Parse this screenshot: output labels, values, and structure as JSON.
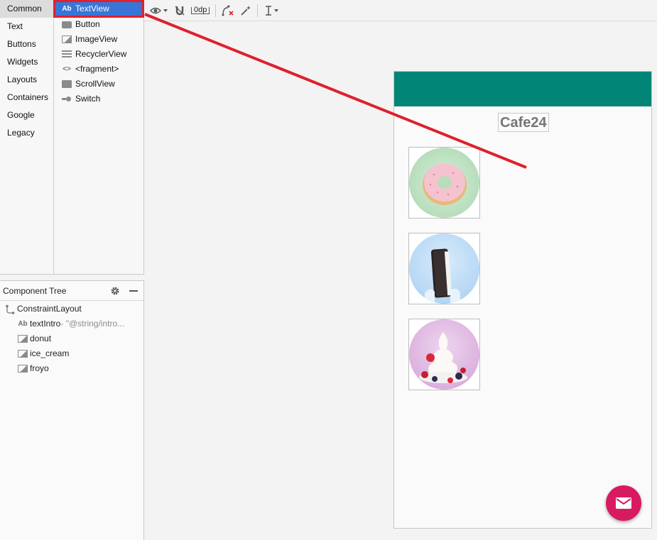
{
  "palette": {
    "categories": [
      "Common",
      "Text",
      "Buttons",
      "Widgets",
      "Layouts",
      "Containers",
      "Google",
      "Legacy"
    ],
    "items": [
      {
        "label": "TextView",
        "icon": "text-ab-icon",
        "badge": "Ab"
      },
      {
        "label": "Button",
        "icon": "button-icon"
      },
      {
        "label": "ImageView",
        "icon": "image-icon"
      },
      {
        "label": "RecyclerView",
        "icon": "list-icon"
      },
      {
        "label": "<fragment>",
        "icon": "code-brackets-icon",
        "glyph": "<>"
      },
      {
        "label": "ScrollView",
        "icon": "scroll-icon"
      },
      {
        "label": "Switch",
        "icon": "switch-icon"
      }
    ]
  },
  "tree": {
    "title": "Component Tree",
    "root": "ConstraintLayout",
    "children": [
      {
        "name": "textIntro",
        "hint": "- \"@string/intro...",
        "badge": "Ab"
      },
      {
        "name": "donut"
      },
      {
        "name": "ice_cream"
      },
      {
        "name": "froyo"
      }
    ]
  },
  "toolbar": {
    "margin_value": "0dp"
  },
  "device": {
    "title_text": "Cafe24",
    "appbar_color": "#008577",
    "fab_color": "#d81b60",
    "images": [
      "donut",
      "ice_cream",
      "froyo"
    ]
  },
  "colors": {
    "selection": "#3875d7",
    "highlight_border": "#e0202a"
  }
}
